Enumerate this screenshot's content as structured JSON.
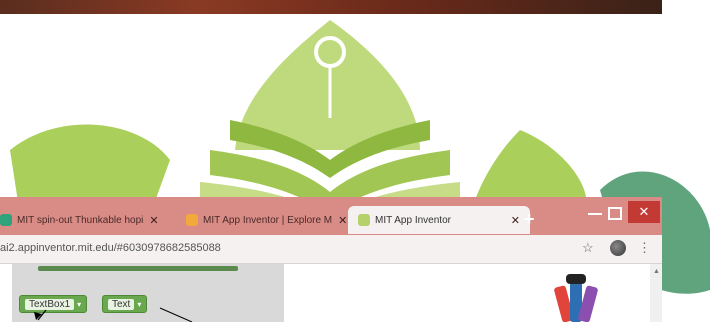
{
  "browser": {
    "tabs": [
      {
        "label": "MIT spin-out Thunkable hopi",
        "favicon_color": "#2fa37a",
        "icon": "thunkable-icon"
      },
      {
        "label": "MIT App Inventor | Explore M",
        "favicon_color": "#f2a93b",
        "icon": "app-inventor-icon"
      },
      {
        "label": "MIT App Inventor",
        "favicon_color": "#b5d16a",
        "icon": "app-inventor-icon"
      }
    ],
    "new_tab": "+",
    "url": "ai2.appinventor.mit.edu/#6030978682585088"
  },
  "workspace": {
    "blocks": [
      {
        "label": "TextBox1",
        "dropdown": "▾"
      },
      {
        "label": "Text",
        "dropdown": "▾"
      }
    ]
  },
  "colors": {
    "tabbar": "#d98c86",
    "watermark_green": "#8cbf4a",
    "watermark_dark": "#4f9a6f",
    "block_green": "#6aa84f"
  }
}
